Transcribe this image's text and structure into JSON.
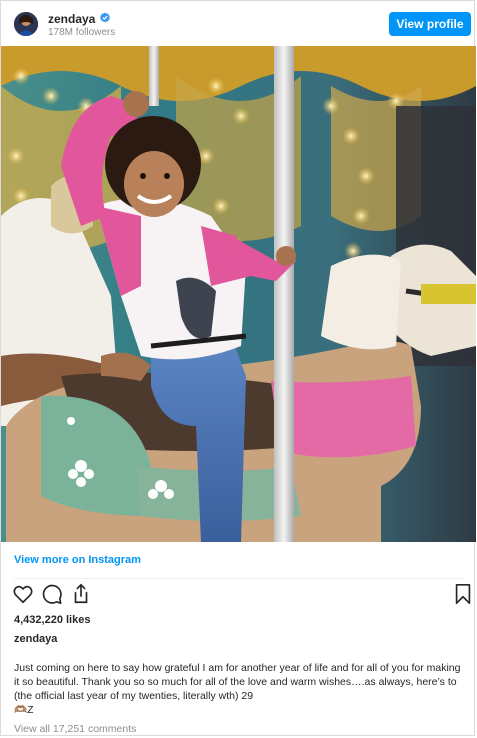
{
  "header": {
    "username": "zendaya",
    "followers": "178M followers",
    "verified_icon": "verified-badge-icon",
    "view_profile_label": "View profile"
  },
  "post": {
    "image_description_icon": "photo",
    "view_more_label": "View more on Instagram",
    "likes": "4,432,220 likes",
    "caption_username": "zendaya",
    "caption_text": "Just coming on here to say how grateful I am for another year of life and for all of you for making it so beautiful. Thank you so so much for all of the love and warm wishes….as always, here’s to (the official last year of my twenties, literally wth) 29",
    "caption_sign": "🫶🏽Z",
    "view_all_comments": "View all 17,251 comments"
  },
  "actions": {
    "like_icon": "heart-icon",
    "comment_icon": "comment-icon",
    "share_icon": "share-icon",
    "save_icon": "bookmark-icon"
  },
  "colors": {
    "accent": "#0095f6",
    "muted": "#8e8e8e",
    "text": "#262626"
  }
}
